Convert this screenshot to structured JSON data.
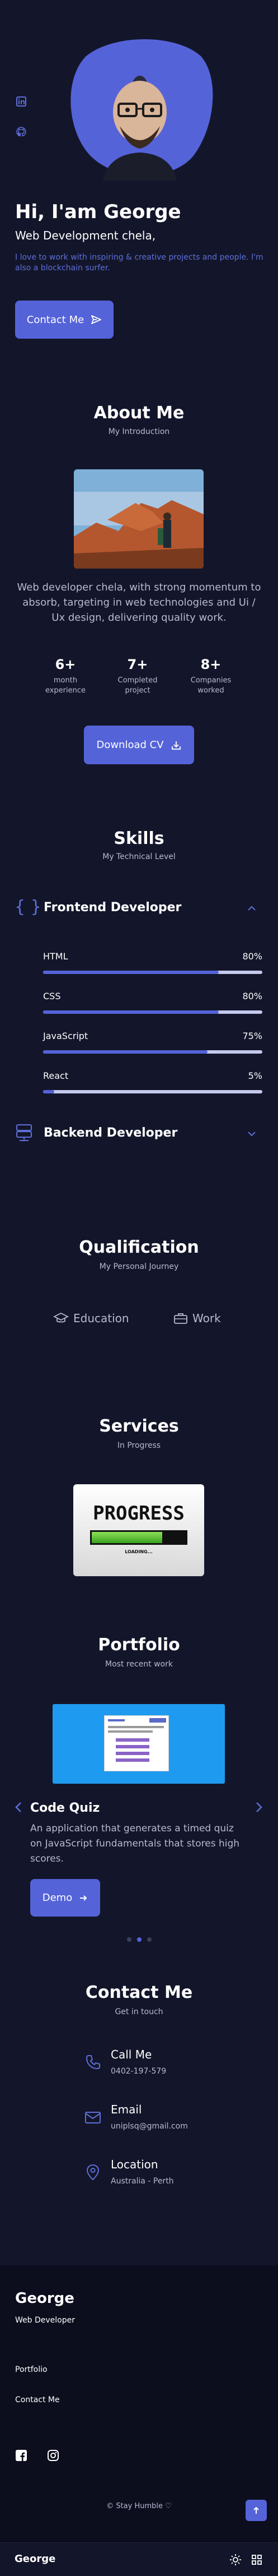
{
  "home": {
    "greeting": "Hi, I'am George",
    "role": "Web Development chela,",
    "description": "I love to work with inspiring & creative projects and people. I'm also a blockchain surfer.",
    "contact_button": "Contact Me"
  },
  "about": {
    "title": "About Me",
    "subtitle": "My Introduction",
    "description": "Web developer chela, with strong momentum to absorb, targeting in web technologies and Ui / Ux design, delivering quality work.",
    "stats": [
      {
        "number": "6+",
        "label": "month experience"
      },
      {
        "number": "7+",
        "label": "Completed project"
      },
      {
        "number": "8+",
        "label": "Companies worked"
      }
    ],
    "download_button": "Download CV"
  },
  "skills": {
    "title": "Skills",
    "subtitle": "My Technical Level",
    "frontend_title": "Frontend Developer",
    "items": [
      {
        "name": "HTML",
        "percent": "80%",
        "level": 0.8
      },
      {
        "name": "CSS",
        "percent": "80%",
        "level": 0.8
      },
      {
        "name": "JavaScript",
        "percent": "75%",
        "level": 0.75
      },
      {
        "name": "React",
        "percent": "5%",
        "level": 0.05
      }
    ],
    "backend_title": "Backend Developer"
  },
  "qualification": {
    "title": "Qualification",
    "subtitle": "My Personal Journey",
    "education_tab": "Education",
    "work_tab": "Work"
  },
  "services": {
    "title": "Services",
    "subtitle": "In Progress",
    "image_text": "PROGRESS",
    "loading_text": "LOADING..."
  },
  "portfolio": {
    "title": "Portfolio",
    "subtitle": "Most recent work",
    "project_title": "Code Quiz",
    "project_description": "An application that generates a timed quiz on JavaScript fundamentals that stores high scores.",
    "demo_button": "Demo"
  },
  "contact": {
    "title": "Contact Me",
    "subtitle": "Get in touch",
    "items": [
      {
        "label": "Call Me",
        "value": "0402-197-579"
      },
      {
        "label": "Email",
        "value": "uniplsq@gmail.com"
      },
      {
        "label": "Location",
        "value": "Australia - Perth"
      }
    ]
  },
  "footer": {
    "name": "George",
    "role": "Web Developer",
    "links": [
      "Portfolio",
      "Contact Me"
    ],
    "copyright": "© Stay Humble ♡"
  },
  "navbar": {
    "logo": "George"
  },
  "colors": {
    "background": "#13162a",
    "footer_bg": "#0c0e1e",
    "accent": "#5563d9",
    "text_muted": "#b7bad0"
  }
}
